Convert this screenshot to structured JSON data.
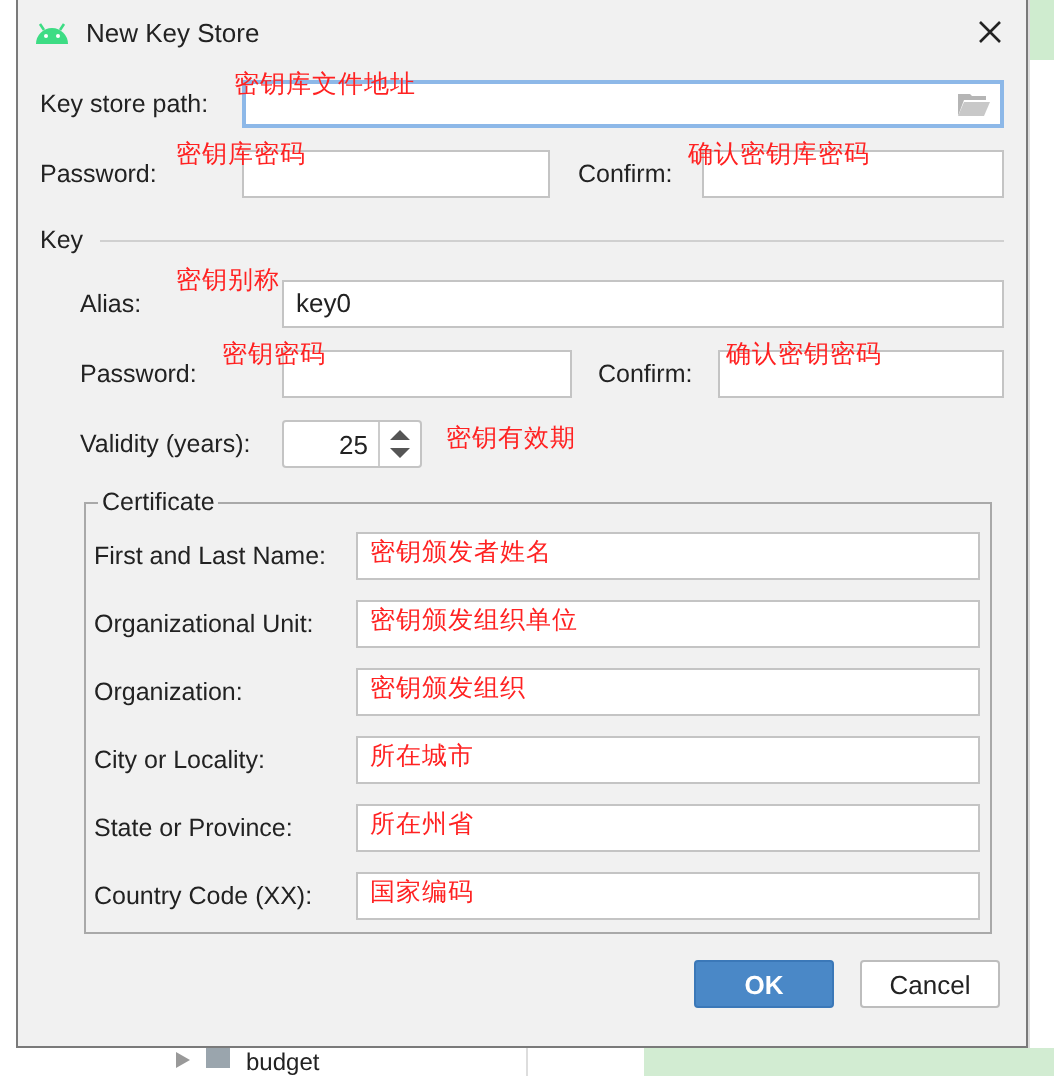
{
  "window": {
    "title": "New Key Store"
  },
  "keystore": {
    "path": {
      "label": "Key store path:",
      "note": "密钥库文件地址",
      "focused": true
    },
    "password": {
      "label": "Password:",
      "note": "密钥库密码"
    },
    "confirm": {
      "label": "Confirm:",
      "note": "确认密钥库密码"
    }
  },
  "key": {
    "title": "Key",
    "alias": {
      "label": "Alias:",
      "note": "密钥别称",
      "value": "key0"
    },
    "password": {
      "label": "Password:",
      "note": "密钥密码"
    },
    "confirm": {
      "label": "Confirm:",
      "note": "确认密钥密码"
    },
    "validity": {
      "label": "Validity (years):",
      "value": "25",
      "note": "密钥有效期"
    }
  },
  "certificate": {
    "title": "Certificate",
    "fields": [
      {
        "label": "First and Last Name:",
        "note": "密钥颁发者姓名"
      },
      {
        "label": "Organizational Unit:",
        "note": "密钥颁发组织单位"
      },
      {
        "label": "Organization:",
        "note": "密钥颁发组织"
      },
      {
        "label": "City or Locality:",
        "note": "所在城市"
      },
      {
        "label": "State or Province:",
        "note": "所在州省"
      },
      {
        "label": "Country Code (XX):",
        "note": "国家编码"
      }
    ]
  },
  "buttons": [
    {
      "label": "OK",
      "kind": "primary"
    },
    {
      "label": "Cancel",
      "kind": "secondary"
    }
  ],
  "background": {
    "tree_item": "budget"
  }
}
